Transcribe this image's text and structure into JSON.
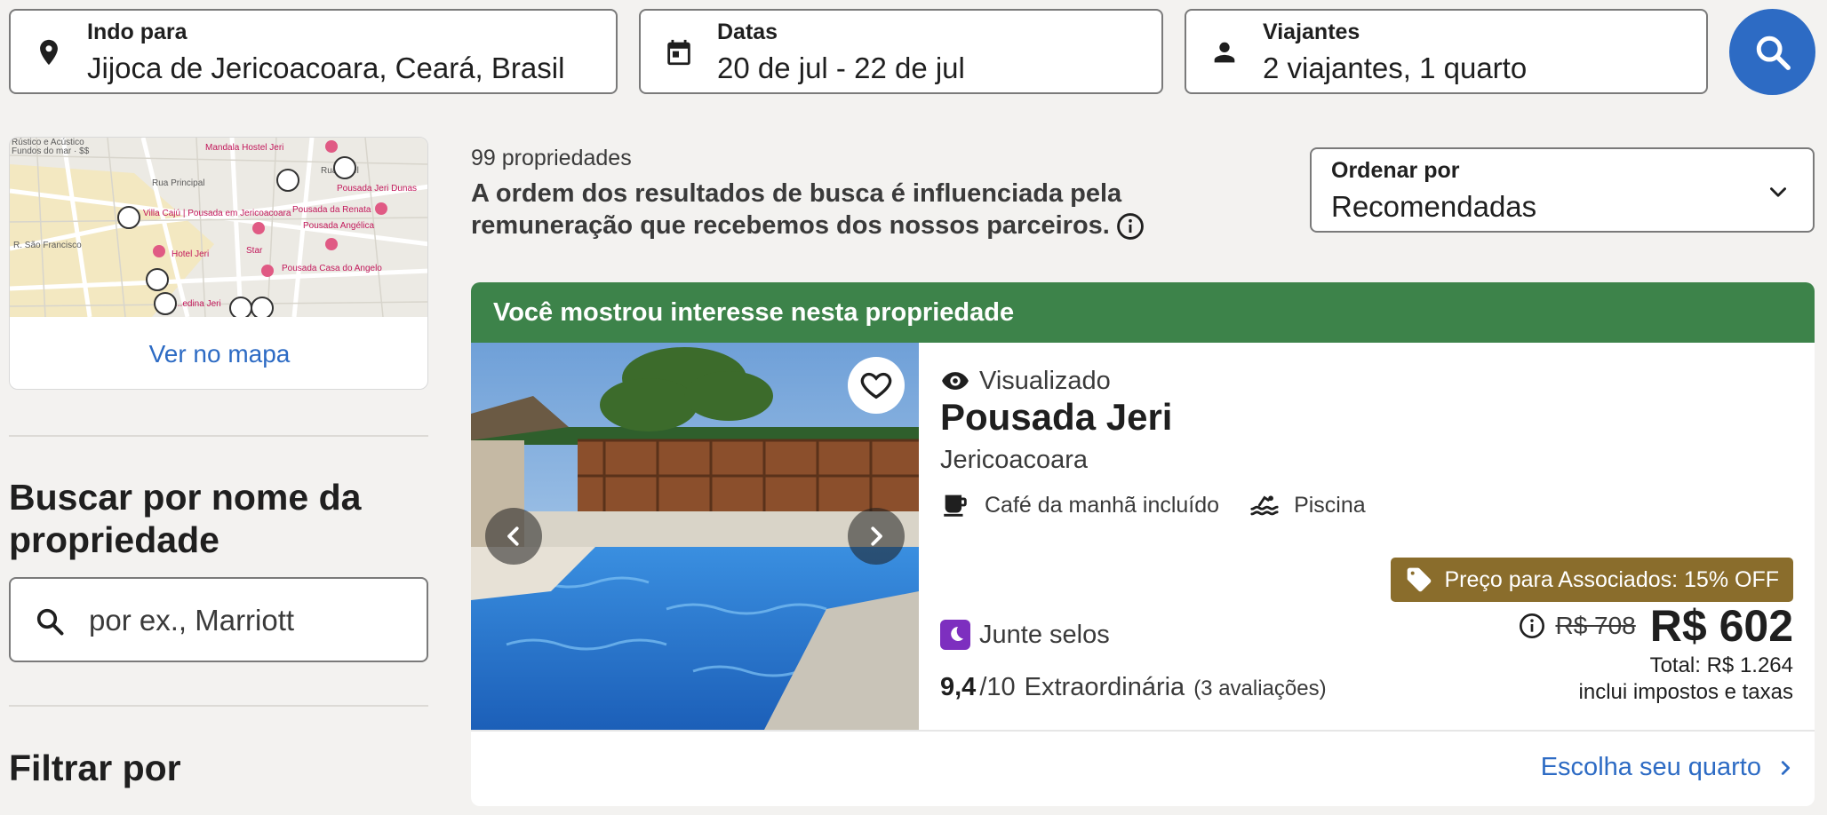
{
  "search": {
    "destination": {
      "label": "Indo para",
      "value": "Jijoca de Jericoacoara, Ceará, Brasil",
      "icon": "map-pin-icon"
    },
    "dates": {
      "label": "Datas",
      "value": "20 de jul - 22 de jul",
      "icon": "calendar-icon"
    },
    "travelers": {
      "label": "Viajantes",
      "value": "2 viajantes, 1 quarto",
      "icon": "person-icon"
    },
    "button_icon": "search-icon"
  },
  "map": {
    "link_label": "Ver no mapa",
    "labels": [
      "Rústico e Acústico",
      "Fundos do mar · $$",
      "Mandala Hostel Jeri",
      "Rua Principal",
      "Rua ...bel",
      "Pousada Jeri Dunas",
      "Villa Cajú | Pousada em Jericoacoara",
      "Pousada da Renata",
      "Pousada Angélica",
      "R. São Francisco",
      "Hotel Jeri",
      "Star",
      "Pousada Casa do Angelo",
      "...edina Jeri"
    ]
  },
  "sidebar": {
    "search_title": "Buscar por nome da propriedade",
    "search_placeholder": "por ex., Marriott",
    "filter_title": "Filtrar por"
  },
  "results": {
    "count": "99 propriedades",
    "disclaimer": "A ordem dos resultados de busca é influenciada pela remuneração que recebemos dos nossos parceiros.",
    "sort": {
      "label": "Ordenar por",
      "value": "Recomendadas"
    }
  },
  "property": {
    "banner": "Você mostrou interesse nesta propriedade",
    "viewed": "Visualizado",
    "name": "Pousada Jeri",
    "city": "Jericoacoara",
    "amenities": [
      {
        "label": "Café da manhã incluído",
        "icon": "coffee-icon"
      },
      {
        "label": "Piscina",
        "icon": "pool-icon"
      }
    ],
    "member_badge": "Preço para Associados: 15% OFF",
    "stamps": "Junte selos",
    "old_price": "R$ 708",
    "price": "R$ 602",
    "total": "Total: R$ 1.264",
    "taxes": "inclui impostos e taxas",
    "rating_score": "9,4",
    "rating_scale": "/10",
    "rating_label": "Extraordinária",
    "rating_reviews": "(3 avaliações)",
    "choose_room": "Escolha seu quarto"
  },
  "colors": {
    "accent": "#2d6bc4",
    "banner": "#3d834a",
    "badge": "#8a6d2c",
    "stamp": "#7d2fbf"
  }
}
